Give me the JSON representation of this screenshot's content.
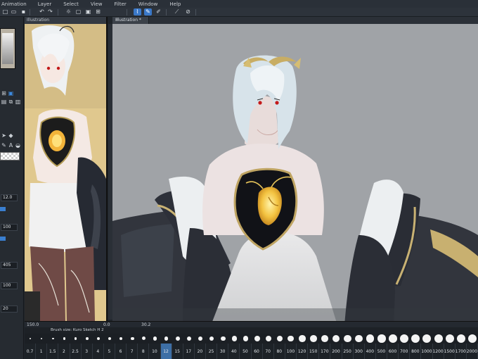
{
  "menu": [
    "Animation",
    "Layer",
    "Select",
    "View",
    "Filter",
    "Window",
    "Help"
  ],
  "toolbar_icons": [
    {
      "name": "new-file-icon",
      "glyph": "□",
      "active": false
    },
    {
      "name": "open-file-icon",
      "glyph": "▭",
      "active": false
    },
    {
      "name": "save-icon",
      "glyph": "▪",
      "active": false
    },
    {
      "name": "undo-icon",
      "glyph": "↶",
      "active": false
    },
    {
      "name": "redo-icon",
      "glyph": "↷",
      "active": false
    },
    {
      "name": "loading-icon",
      "glyph": "☼",
      "active": false
    },
    {
      "name": "clear-icon",
      "glyph": "▢",
      "active": false
    },
    {
      "name": "fill-icon",
      "glyph": "▣",
      "active": false
    },
    {
      "name": "transform-icon",
      "glyph": "⊞",
      "active": false
    },
    {
      "name": "pen-stabilization-icon",
      "glyph": "⌇",
      "active": true
    },
    {
      "name": "brush-icon",
      "glyph": "✎",
      "active": true
    },
    {
      "name": "pen-icon",
      "glyph": "✐",
      "active": false
    },
    {
      "name": "snap-icon",
      "glyph": "⟋",
      "active": false
    },
    {
      "name": "ruler-icon",
      "glyph": "⊘",
      "active": false
    }
  ],
  "left_tools": {
    "values": [
      "12.0",
      "100",
      "405",
      "100",
      "20"
    ]
  },
  "side_canvas": {
    "tab_label": "Illustration"
  },
  "main_canvas": {
    "tab_label": "Illustration *",
    "tab_close": "×"
  },
  "status": {
    "zoom": "150.0",
    "angle": "0.0",
    "x": "30.2"
  },
  "brush_size_bar": {
    "title": "Brush size: Kuro Sketch H 2",
    "sizes": [
      "0.7",
      "1",
      "1.5",
      "2",
      "2.5",
      "3",
      "4",
      "5",
      "6",
      "7",
      "8",
      "10",
      "12",
      "15",
      "17",
      "20",
      "25",
      "30",
      "40",
      "50",
      "60",
      "70",
      "80",
      "100",
      "120",
      "150",
      "170",
      "200",
      "250",
      "300",
      "400",
      "500",
      "600",
      "700",
      "800",
      "1000",
      "1200",
      "1500",
      "1700",
      "2000"
    ],
    "selected": "12"
  },
  "colors": {
    "accent": "#3a78c8",
    "canvas_bg": "#9fa2a6",
    "side_bg": "#d8c28a"
  }
}
